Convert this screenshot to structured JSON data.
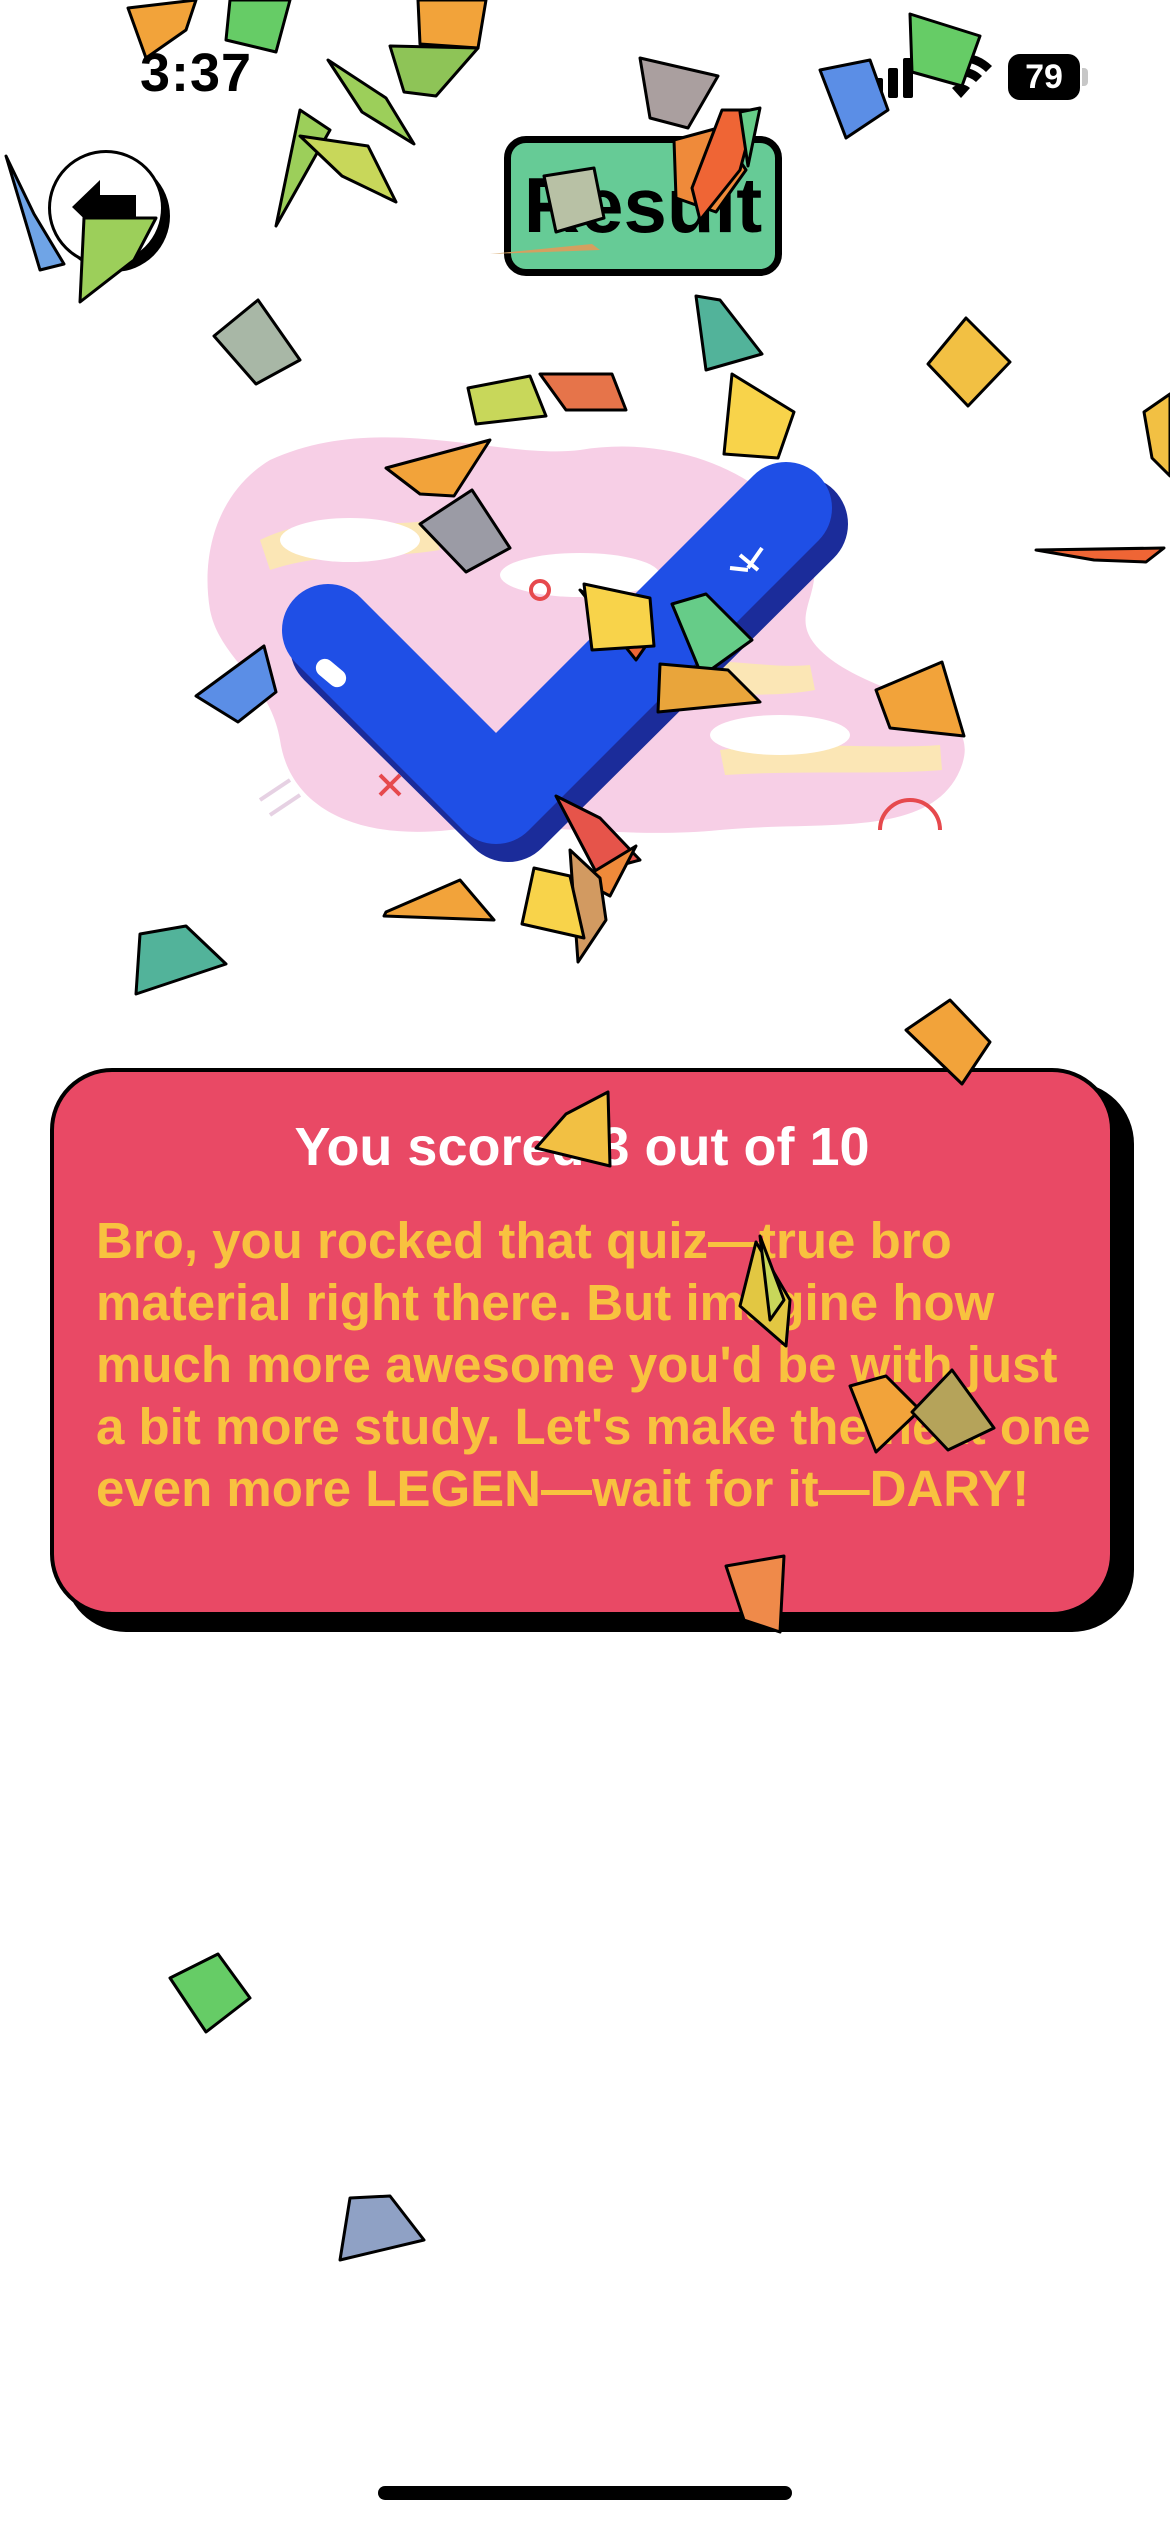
{
  "status_bar": {
    "time": "3:37",
    "battery_level": "79",
    "signal_icon": "cellular-signal-icon",
    "wifi_icon": "wifi-icon",
    "battery_icon": "battery-icon"
  },
  "header": {
    "back_icon": "arrow-left-icon",
    "title": "Result"
  },
  "hero": {
    "illustration": "checkmark-illustration"
  },
  "result": {
    "score_text": "You scored 3 out of 10",
    "message": "Bro, you rocked that quiz—true bro material right there. But imagine how much more awesome you'd be with just a bit more study. Let's make the next one even more LEGEN—wait for it—DARY!"
  },
  "colors": {
    "title_pill": "#66cb96",
    "card": "#e94965",
    "message_text": "#f8c23f",
    "checkmark": "#1f4fe6"
  }
}
